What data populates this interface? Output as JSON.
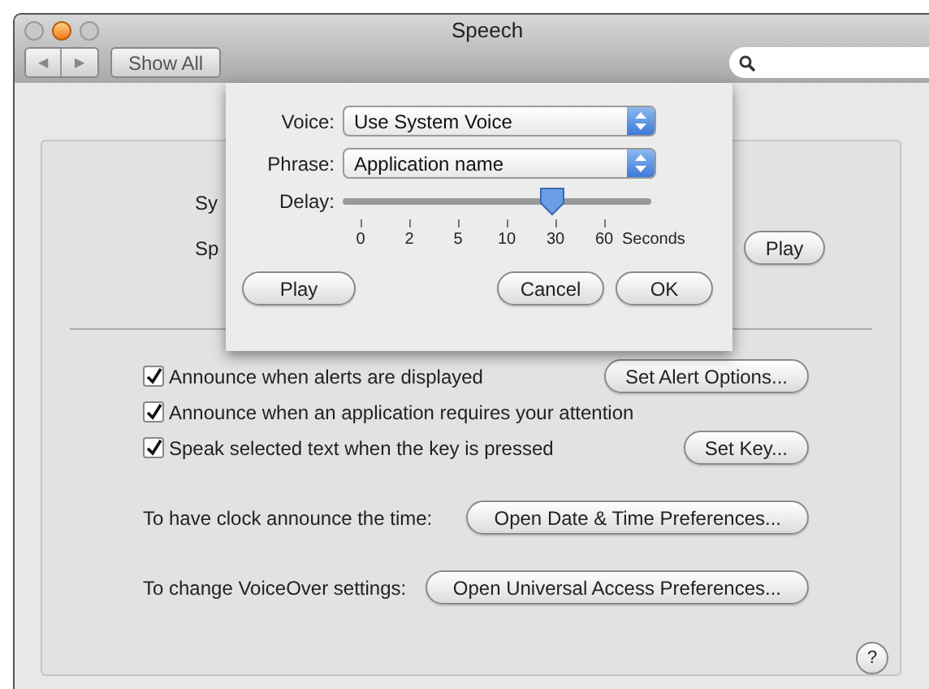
{
  "window": {
    "title": "Speech"
  },
  "toolbar": {
    "back": "◀",
    "forward": "▶",
    "show_all": "Show All"
  },
  "background": {
    "cut_labels": [
      "Sy",
      "Sp"
    ],
    "play_button": "Play"
  },
  "options": [
    {
      "label": "Announce when alerts are displayed",
      "checked": true,
      "button": "Set Alert Options..."
    },
    {
      "label": "Announce when an application requires your attention",
      "checked": true
    },
    {
      "label": "Speak selected text when the key is pressed",
      "checked": true,
      "button": "Set Key..."
    }
  ],
  "links": [
    {
      "label": "To have clock announce the time:",
      "button": "Open Date & Time Preferences..."
    },
    {
      "label": "To change VoiceOver settings:",
      "button": "Open Universal Access Preferences..."
    }
  ],
  "help": "?",
  "sheet": {
    "voice": {
      "label": "Voice:",
      "value": "Use System Voice"
    },
    "phrase": {
      "label": "Phrase:",
      "value": "Application name"
    },
    "delay": {
      "label": "Delay:",
      "level": 0.68,
      "ticks": [
        "0",
        "2",
        "5",
        "10",
        "30",
        "60"
      ],
      "unit": "Seconds"
    },
    "buttons": {
      "play": "Play",
      "cancel": "Cancel",
      "ok": "OK"
    }
  }
}
